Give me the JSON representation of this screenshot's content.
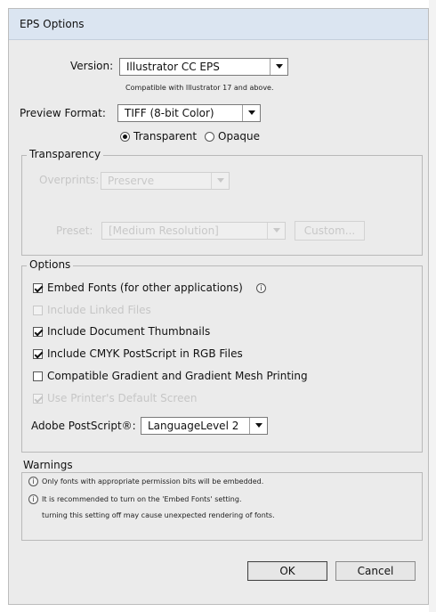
{
  "window": {
    "title": "EPS Options"
  },
  "version": {
    "label": "Version:",
    "value": "Illustrator CC EPS",
    "note": "Compatible with Illustrator 17 and above."
  },
  "preview": {
    "label": "Preview Format:",
    "value": "TIFF (8-bit Color)",
    "transparent": "Transparent",
    "opaque": "Opaque",
    "selected": "Transparent"
  },
  "transparency": {
    "legend": "Transparency",
    "overprints_label": "Overprints:",
    "overprints_value": "Preserve",
    "preset_label": "Preset:",
    "preset_value": "[Medium Resolution]",
    "custom_label": "Custom..."
  },
  "options": {
    "legend": "Options",
    "embed_fonts": {
      "label": "Embed Fonts (for other applications)",
      "checked": true,
      "enabled": true
    },
    "include_linked": {
      "label": "Include Linked Files",
      "checked": false,
      "enabled": false
    },
    "include_thumbnails": {
      "label": "Include Document Thumbnails",
      "checked": true,
      "enabled": true
    },
    "include_cmyk": {
      "label": "Include CMYK PostScript in RGB Files",
      "checked": true,
      "enabled": true
    },
    "compatible_gradient": {
      "label": "Compatible Gradient and Gradient Mesh Printing",
      "checked": false,
      "enabled": true
    },
    "printer_screens": {
      "label": "Use Printer's Default Screen",
      "checked": true,
      "enabled": false
    },
    "postscript_label": "Adobe PostScript®:",
    "postscript_value": "LanguageLevel 2"
  },
  "warnings": {
    "legend": "Warnings",
    "items": [
      "Only fonts with appropriate permission bits will be embedded.",
      "It is recommended to turn on the 'Embed Fonts' setting.",
      "turning this setting off may cause unexpected rendering of fonts."
    ]
  },
  "buttons": {
    "ok": "OK",
    "cancel": "Cancel"
  }
}
